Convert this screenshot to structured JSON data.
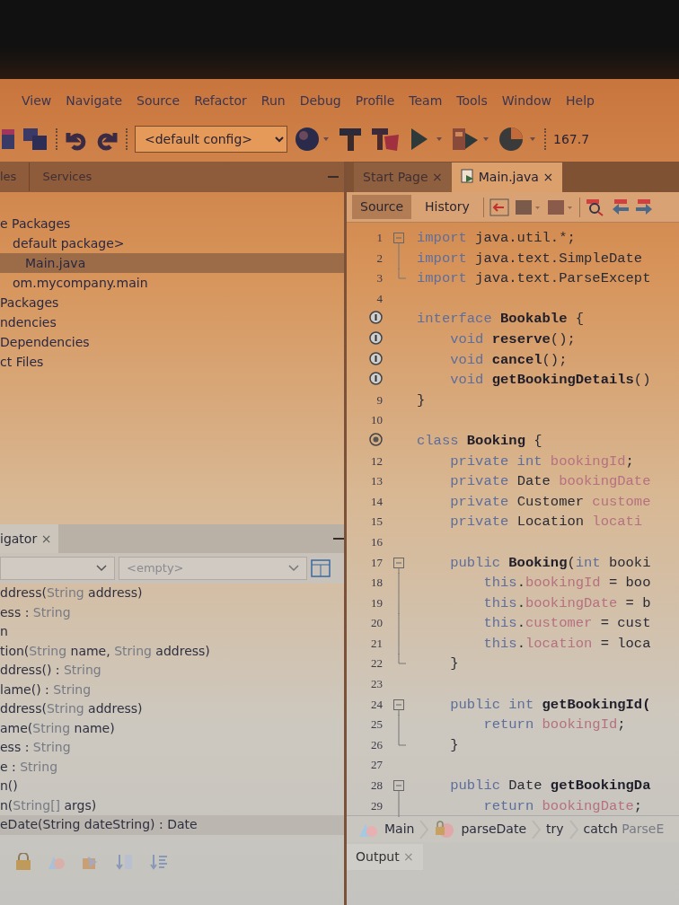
{
  "menu": [
    "View",
    "Navigate",
    "Source",
    "Refactor",
    "Run",
    "Debug",
    "Profile",
    "Team",
    "Tools",
    "Window",
    "Help"
  ],
  "toolbar": {
    "config": "<default config>",
    "memory": "167.7"
  },
  "projects": {
    "tabs": [
      {
        "label": "les"
      },
      {
        "label": "Services"
      }
    ],
    "tree": [
      {
        "label": "e Packages",
        "selected": false,
        "children": [
          {
            "label": "default package>",
            "selected": false,
            "children": [
              {
                "label": "Main.java",
                "selected": true
              }
            ]
          },
          {
            "label": "om.mycompany.main",
            "selected": false
          }
        ]
      },
      {
        "label": "Packages",
        "selected": false
      },
      {
        "label": "ndencies",
        "selected": false
      },
      {
        "label": "Dependencies",
        "selected": false
      },
      {
        "label": "ct Files",
        "selected": false
      }
    ]
  },
  "navigator": {
    "tab": "igator",
    "close": "×",
    "filter": "<empty>",
    "items": [
      {
        "selected": false,
        "parts": [
          {
            "kind": "name",
            "text": "ddress("
          },
          {
            "kind": "type",
            "text": "String"
          },
          {
            "kind": "name",
            "text": " address)"
          }
        ]
      },
      {
        "selected": false,
        "parts": [
          {
            "kind": "name",
            "text": "ess : "
          },
          {
            "kind": "type",
            "text": "String"
          }
        ]
      },
      {
        "selected": false,
        "parts": [
          {
            "kind": "name",
            "text": "n"
          }
        ]
      },
      {
        "selected": false,
        "parts": [
          {
            "kind": "name",
            "text": "tion("
          },
          {
            "kind": "type",
            "text": "String"
          },
          {
            "kind": "name",
            "text": " name, "
          },
          {
            "kind": "type",
            "text": "String"
          },
          {
            "kind": "name",
            "text": " address)"
          }
        ]
      },
      {
        "selected": false,
        "parts": [
          {
            "kind": "name",
            "text": "ddress() : "
          },
          {
            "kind": "type",
            "text": "String"
          }
        ]
      },
      {
        "selected": false,
        "parts": [
          {
            "kind": "name",
            "text": "lame() : "
          },
          {
            "kind": "type",
            "text": "String"
          }
        ]
      },
      {
        "selected": false,
        "parts": [
          {
            "kind": "name",
            "text": "ddress("
          },
          {
            "kind": "type",
            "text": "String"
          },
          {
            "kind": "name",
            "text": " address)"
          }
        ]
      },
      {
        "selected": false,
        "parts": [
          {
            "kind": "name",
            "text": "ame("
          },
          {
            "kind": "type",
            "text": "String"
          },
          {
            "kind": "name",
            "text": " name)"
          }
        ]
      },
      {
        "selected": false,
        "parts": [
          {
            "kind": "name",
            "text": "ess : "
          },
          {
            "kind": "type",
            "text": "String"
          }
        ]
      },
      {
        "selected": false,
        "parts": [
          {
            "kind": "name",
            "text": "e : "
          },
          {
            "kind": "type",
            "text": "String"
          }
        ]
      },
      {
        "selected": false,
        "parts": [
          {
            "kind": "name",
            "text": "n()"
          }
        ]
      },
      {
        "selected": false,
        "parts": [
          {
            "kind": "name",
            "text": "n("
          },
          {
            "kind": "type",
            "text": "String[]"
          },
          {
            "kind": "name",
            "text": " args)"
          }
        ]
      },
      {
        "selected": true,
        "parts": [
          {
            "kind": "name",
            "text": "eDate(String dateString) : Date"
          }
        ]
      }
    ]
  },
  "editor": {
    "tabs": [
      {
        "label": "Start Page",
        "close": "×",
        "selected": false
      },
      {
        "label": "Main.java",
        "close": "×",
        "selected": true
      }
    ],
    "views": [
      {
        "label": "Source",
        "selected": true
      },
      {
        "label": "History",
        "selected": false
      }
    ],
    "lines": [
      {
        "kind": "numbered",
        "number": "1",
        "fold_start": true,
        "in_fold": false,
        "fold_end": false,
        "tokens": [
          {
            "kind": "keyword",
            "text": "import"
          },
          {
            "kind": "plain",
            "text": " java.util.*;"
          }
        ]
      },
      {
        "kind": "numbered",
        "number": "2",
        "fold_start": false,
        "in_fold": true,
        "fold_end": false,
        "tokens": [
          {
            "kind": "keyword",
            "text": "import"
          },
          {
            "kind": "plain",
            "text": " java.text.SimpleDate"
          }
        ]
      },
      {
        "kind": "numbered",
        "number": "3",
        "fold_start": false,
        "in_fold": false,
        "fold_end": true,
        "tokens": [
          {
            "kind": "keyword",
            "text": "import"
          },
          {
            "kind": "plain",
            "text": " java.text.ParseExcept"
          }
        ]
      },
      {
        "kind": "numbered",
        "number": "4",
        "fold_start": false,
        "in_fold": false,
        "fold_end": false
      },
      {
        "kind": "interface",
        "fold_start": false,
        "in_fold": false,
        "fold_end": false,
        "tokens": [
          {
            "kind": "keyword",
            "text": "interface"
          },
          {
            "kind": "bold",
            "text": " Bookable"
          },
          {
            "kind": "plain",
            "text": " {"
          }
        ]
      },
      {
        "kind": "interface",
        "fold_start": false,
        "in_fold": false,
        "fold_end": false,
        "tokens": [
          {
            "kind": "keyword",
            "text": "    void"
          },
          {
            "kind": "bold",
            "text": " reserve"
          },
          {
            "kind": "plain",
            "text": "();"
          }
        ]
      },
      {
        "kind": "interface",
        "fold_start": false,
        "in_fold": false,
        "fold_end": false,
        "tokens": [
          {
            "kind": "keyword",
            "text": "    void"
          },
          {
            "kind": "bold",
            "text": " cancel"
          },
          {
            "kind": "plain",
            "text": "();"
          }
        ]
      },
      {
        "kind": "interface",
        "fold_start": false,
        "in_fold": false,
        "fold_end": false,
        "tokens": [
          {
            "kind": "keyword",
            "text": "    void"
          },
          {
            "kind": "bold",
            "text": " getBookingDetails"
          },
          {
            "kind": "plain",
            "text": "()"
          }
        ]
      },
      {
        "kind": "numbered",
        "number": "9",
        "fold_start": false,
        "in_fold": false,
        "fold_end": false,
        "tokens": [
          {
            "kind": "plain",
            "text": "}"
          }
        ]
      },
      {
        "kind": "numbered",
        "number": "10",
        "fold_start": false,
        "in_fold": false,
        "fold_end": false
      },
      {
        "kind": "class",
        "fold_start": false,
        "in_fold": false,
        "fold_end": false,
        "tokens": [
          {
            "kind": "keyword",
            "text": "class"
          },
          {
            "kind": "bold",
            "text": " Booking"
          },
          {
            "kind": "plain",
            "text": " {"
          }
        ]
      },
      {
        "kind": "numbered",
        "number": "12",
        "fold_start": false,
        "in_fold": false,
        "fold_end": false,
        "tokens": [
          {
            "kind": "keyword",
            "text": "    private int"
          },
          {
            "kind": "field",
            "text": " bookingId"
          },
          {
            "kind": "plain",
            "text": ";"
          }
        ]
      },
      {
        "kind": "numbered",
        "number": "13",
        "fold_start": false,
        "in_fold": false,
        "fold_end": false,
        "tokens": [
          {
            "kind": "keyword",
            "text": "    private"
          },
          {
            "kind": "plain",
            "text": " Date"
          },
          {
            "kind": "field",
            "text": " bookingDate"
          }
        ]
      },
      {
        "kind": "numbered",
        "number": "14",
        "fold_start": false,
        "in_fold": false,
        "fold_end": false,
        "tokens": [
          {
            "kind": "keyword",
            "text": "    private"
          },
          {
            "kind": "plain",
            "text": " Customer"
          },
          {
            "kind": "field",
            "text": " custome"
          }
        ]
      },
      {
        "kind": "numbered",
        "number": "15",
        "fold_start": false,
        "in_fold": false,
        "fold_end": false,
        "tokens": [
          {
            "kind": "keyword",
            "text": "    private"
          },
          {
            "kind": "plain",
            "text": " Location"
          },
          {
            "kind": "field",
            "text": " locati"
          }
        ]
      },
      {
        "kind": "numbered",
        "number": "16",
        "fold_start": false,
        "in_fold": false,
        "fold_end": false
      },
      {
        "kind": "numbered",
        "number": "17",
        "fold_start": true,
        "in_fold": false,
        "fold_end": false,
        "tokens": [
          {
            "kind": "keyword",
            "text": "    public"
          },
          {
            "kind": "bold",
            "text": " Booking"
          },
          {
            "kind": "plain",
            "text": "("
          },
          {
            "kind": "keyword",
            "text": "int"
          },
          {
            "kind": "plain",
            "text": " booki"
          }
        ]
      },
      {
        "kind": "numbered",
        "number": "18",
        "fold_start": false,
        "in_fold": true,
        "fold_end": false,
        "tokens": [
          {
            "kind": "keyword",
            "text": "        this"
          },
          {
            "kind": "plain",
            "text": "."
          },
          {
            "kind": "field",
            "text": "bookingId"
          },
          {
            "kind": "plain",
            "text": " = boo"
          }
        ]
      },
      {
        "kind": "numbered",
        "number": "19",
        "fold_start": false,
        "in_fold": true,
        "fold_end": false,
        "tokens": [
          {
            "kind": "keyword",
            "text": "        this"
          },
          {
            "kind": "plain",
            "text": "."
          },
          {
            "kind": "field",
            "text": "bookingDate"
          },
          {
            "kind": "plain",
            "text": " = b"
          }
        ]
      },
      {
        "kind": "numbered",
        "number": "20",
        "fold_start": false,
        "in_fold": true,
        "fold_end": false,
        "tokens": [
          {
            "kind": "keyword",
            "text": "        this"
          },
          {
            "kind": "plain",
            "text": "."
          },
          {
            "kind": "field",
            "text": "customer"
          },
          {
            "kind": "plain",
            "text": " = cust"
          }
        ]
      },
      {
        "kind": "numbered",
        "number": "21",
        "fold_start": false,
        "in_fold": true,
        "fold_end": false,
        "tokens": [
          {
            "kind": "keyword",
            "text": "        this"
          },
          {
            "kind": "plain",
            "text": "."
          },
          {
            "kind": "field",
            "text": "location"
          },
          {
            "kind": "plain",
            "text": " = loca"
          }
        ]
      },
      {
        "kind": "numbered",
        "number": "22",
        "fold_start": false,
        "in_fold": false,
        "fold_end": true,
        "tokens": [
          {
            "kind": "plain",
            "text": "    }"
          }
        ]
      },
      {
        "kind": "numbered",
        "number": "23",
        "fold_start": false,
        "in_fold": false,
        "fold_end": false
      },
      {
        "kind": "numbered",
        "number": "24",
        "fold_start": true,
        "in_fold": false,
        "fold_end": false,
        "tokens": [
          {
            "kind": "keyword",
            "text": "    public int"
          },
          {
            "kind": "bold",
            "text": " getBookingId("
          }
        ]
      },
      {
        "kind": "numbered",
        "number": "25",
        "fold_start": false,
        "in_fold": true,
        "fold_end": false,
        "tokens": [
          {
            "kind": "keyword",
            "text": "        return"
          },
          {
            "kind": "field",
            "text": " bookingId"
          },
          {
            "kind": "plain",
            "text": ";"
          }
        ]
      },
      {
        "kind": "numbered",
        "number": "26",
        "fold_start": false,
        "in_fold": false,
        "fold_end": true,
        "tokens": [
          {
            "kind": "plain",
            "text": "    }"
          }
        ]
      },
      {
        "kind": "numbered",
        "number": "27",
        "fold_start": false,
        "in_fold": false,
        "fold_end": false
      },
      {
        "kind": "numbered",
        "number": "28",
        "fold_start": true,
        "in_fold": false,
        "fold_end": false,
        "tokens": [
          {
            "kind": "keyword",
            "text": "    public"
          },
          {
            "kind": "plain",
            "text": " Date"
          },
          {
            "kind": "bold",
            "text": " getBookingDa"
          }
        ]
      },
      {
        "kind": "numbered",
        "number": "29",
        "fold_start": false,
        "in_fold": true,
        "fold_end": false,
        "tokens": [
          {
            "kind": "keyword",
            "text": "        return"
          },
          {
            "kind": "field",
            "text": " bookingDate"
          },
          {
            "kind": "plain",
            "text": ";"
          }
        ]
      }
    ],
    "breadcrumbs": [
      {
        "parts": [
          {
            "kind": "name",
            "text": "Main"
          }
        ]
      },
      {
        "parts": [
          {
            "kind": "name",
            "text": "parseDate"
          }
        ]
      },
      {
        "parts": [
          {
            "kind": "name",
            "text": "try"
          }
        ]
      },
      {
        "parts": [
          {
            "kind": "name",
            "text": "catch "
          },
          {
            "kind": "type",
            "text": "ParseE"
          }
        ]
      }
    ]
  },
  "output": {
    "tab": "Output",
    "close": "×"
  }
}
